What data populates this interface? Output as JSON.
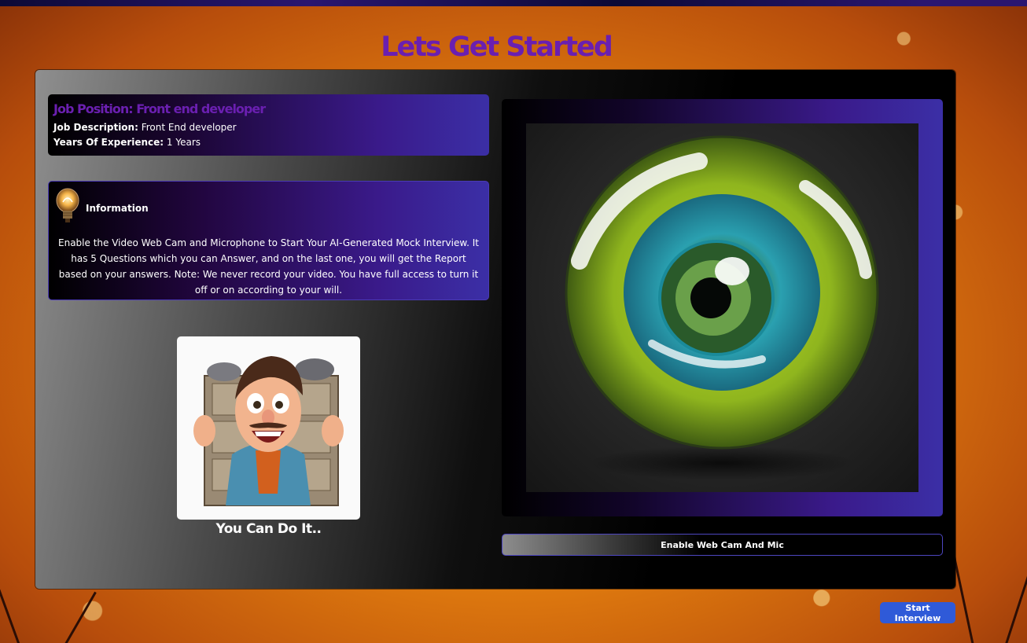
{
  "page": {
    "title": "Lets Get Started"
  },
  "job": {
    "position_label": "Job Position:",
    "position_value": "Front end developer",
    "description_label": "Job Description:",
    "description_value": "Front End developer",
    "experience_label": "Years Of Experience:",
    "experience_value": "1 Years"
  },
  "information": {
    "icon": "lightbulb-icon",
    "heading": "Information",
    "text": "Enable the Video Web Cam and Microphone to Start Your AI-Generated Mock Interview. It has 5 Questions which you can Answer, and on the last one, you will get the Report based on your answers. Note: We never record your video. You have full access to turn it off or on according to your will."
  },
  "motivation": {
    "caption": "You Can Do It.."
  },
  "webcam": {
    "button_label": "Enable Web Cam And Mic"
  },
  "actions": {
    "start_label": "Start Interview"
  },
  "colors": {
    "title": "#6a1fb0",
    "card_gradient_end": "#3b2fa6",
    "start_button": "#2f5ad8",
    "background": "#e07b0e"
  }
}
